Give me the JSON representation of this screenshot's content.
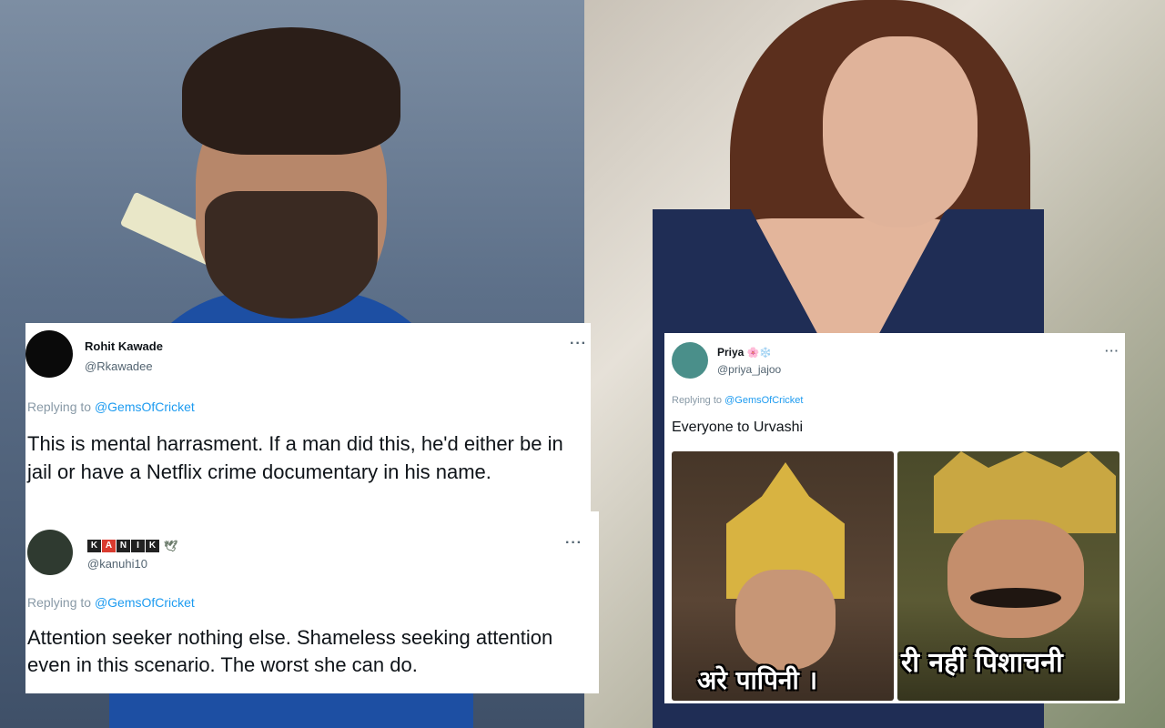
{
  "tweets": [
    {
      "name": "Rohit Kawade",
      "handle": "@Rkawadee",
      "more": "···",
      "replying_prefix": "Replying to",
      "replying_to": "@GemsOfCricket",
      "text": "This is mental harrasment. If a man did this, he'd either be in jail or have a Netflix crime documentary in his name."
    },
    {
      "name_letters": [
        "K",
        "A",
        "N",
        "I",
        "K"
      ],
      "name_suffix": "🕊",
      "handle": "@kanuhi10",
      "more": "···",
      "replying_prefix": "Replying to",
      "replying_to": "@GemsOfCricket",
      "text": "Attention seeker nothing else. Shameless seeking attention even in this scenario. The worst she can do."
    },
    {
      "name": "Priya",
      "name_emoji": "🌸❄️",
      "handle": "@priya_jajoo",
      "more": "···",
      "replying_prefix": "Replying to",
      "replying_to": "@GemsOfCricket",
      "text": "Everyone to Urvashi",
      "meme": {
        "left_caption": "अरे पापिनी ।",
        "right_caption": "री नहीं पिशाचनी"
      }
    }
  ],
  "icons": {
    "more": "more-options-icon",
    "leaf": "dove-icon"
  },
  "colors": {
    "link": "#1d9bf0",
    "muted": "#536471",
    "card_bg": "#ffffff",
    "shirt": "#1d4fa3",
    "dress": "#1f2d55"
  }
}
